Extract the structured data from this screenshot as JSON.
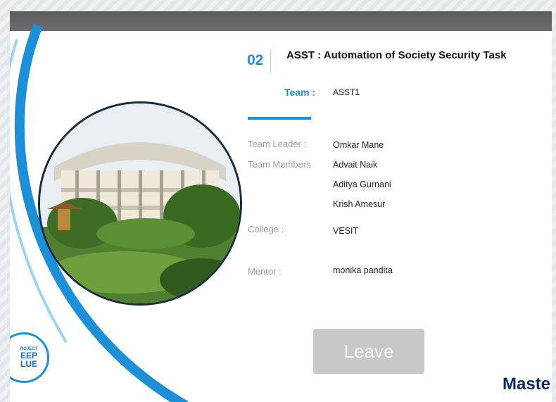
{
  "task": {
    "number": "02",
    "title": "ASST : Automation of Society Security Task"
  },
  "team": {
    "label": "Team :",
    "value": "ASST1"
  },
  "details": {
    "leader_label": "Team Leader :",
    "leader": "Omkar Mane",
    "members_label": "Team Members",
    "members": [
      "Advait Naik",
      "Aditya Gurnani",
      "Krish Amesur"
    ],
    "college_label": "College :",
    "college": "VESIT",
    "mentor_label": "Mentor :",
    "mentor": "monika pandita"
  },
  "actions": {
    "leave_label": "Leave"
  },
  "logo": {
    "line1": "ROJECT",
    "line2": "EEP",
    "line3": "LUE"
  },
  "brand": {
    "text": "Maste"
  },
  "colors": {
    "accent": "#1c8fd6",
    "topbar": "#646466",
    "button": "#c8c8c8",
    "brand": "#0b2b6b"
  }
}
